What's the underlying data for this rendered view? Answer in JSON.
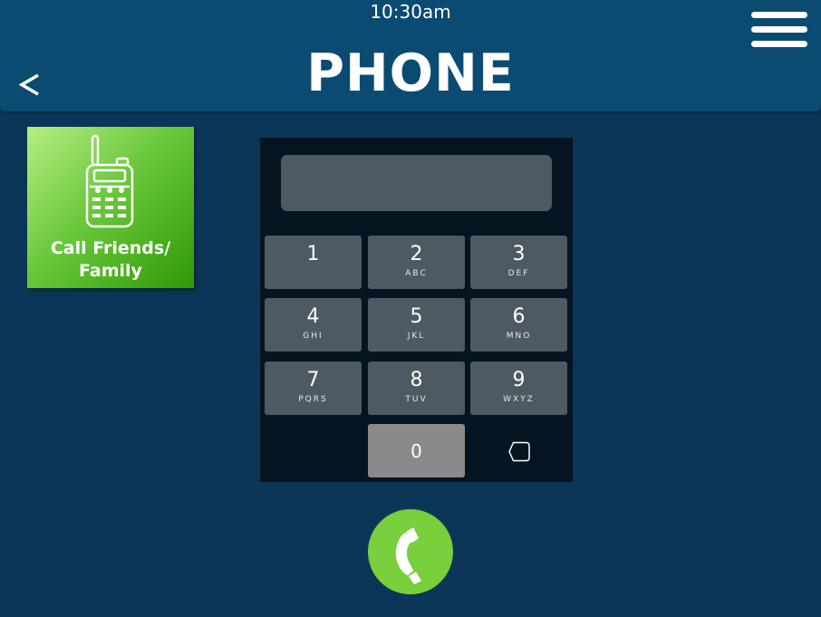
{
  "status": {
    "time": "10:30am"
  },
  "header": {
    "title": "PHONE",
    "back_icon": "chevron-left-icon",
    "menu_icon": "hamburger-menu-icon"
  },
  "shortcut": {
    "label_line1": "Call Friends/",
    "label_line2": "Family",
    "icon": "walkie-talkie-icon"
  },
  "dialer": {
    "display_value": "",
    "keys": [
      {
        "digit": "1",
        "letters": ""
      },
      {
        "digit": "2",
        "letters": "ABC"
      },
      {
        "digit": "3",
        "letters": "DEF"
      },
      {
        "digit": "4",
        "letters": "GHI"
      },
      {
        "digit": "5",
        "letters": "JKL"
      },
      {
        "digit": "6",
        "letters": "MNO"
      },
      {
        "digit": "7",
        "letters": "PQRS"
      },
      {
        "digit": "8",
        "letters": "TUV"
      },
      {
        "digit": "9",
        "letters": "WXYZ"
      }
    ],
    "zero": "0",
    "backspace_icon": "backspace-icon"
  },
  "call": {
    "icon": "phone-handset-icon"
  },
  "colors": {
    "background": "#0c3657",
    "header": "#0b4b72",
    "key": "#4e5a62",
    "zero_key": "#8a8a8a",
    "call_button": "#79cf3c",
    "tile_gradient_start": "#b6ee82",
    "tile_gradient_end": "#2f9a07"
  }
}
